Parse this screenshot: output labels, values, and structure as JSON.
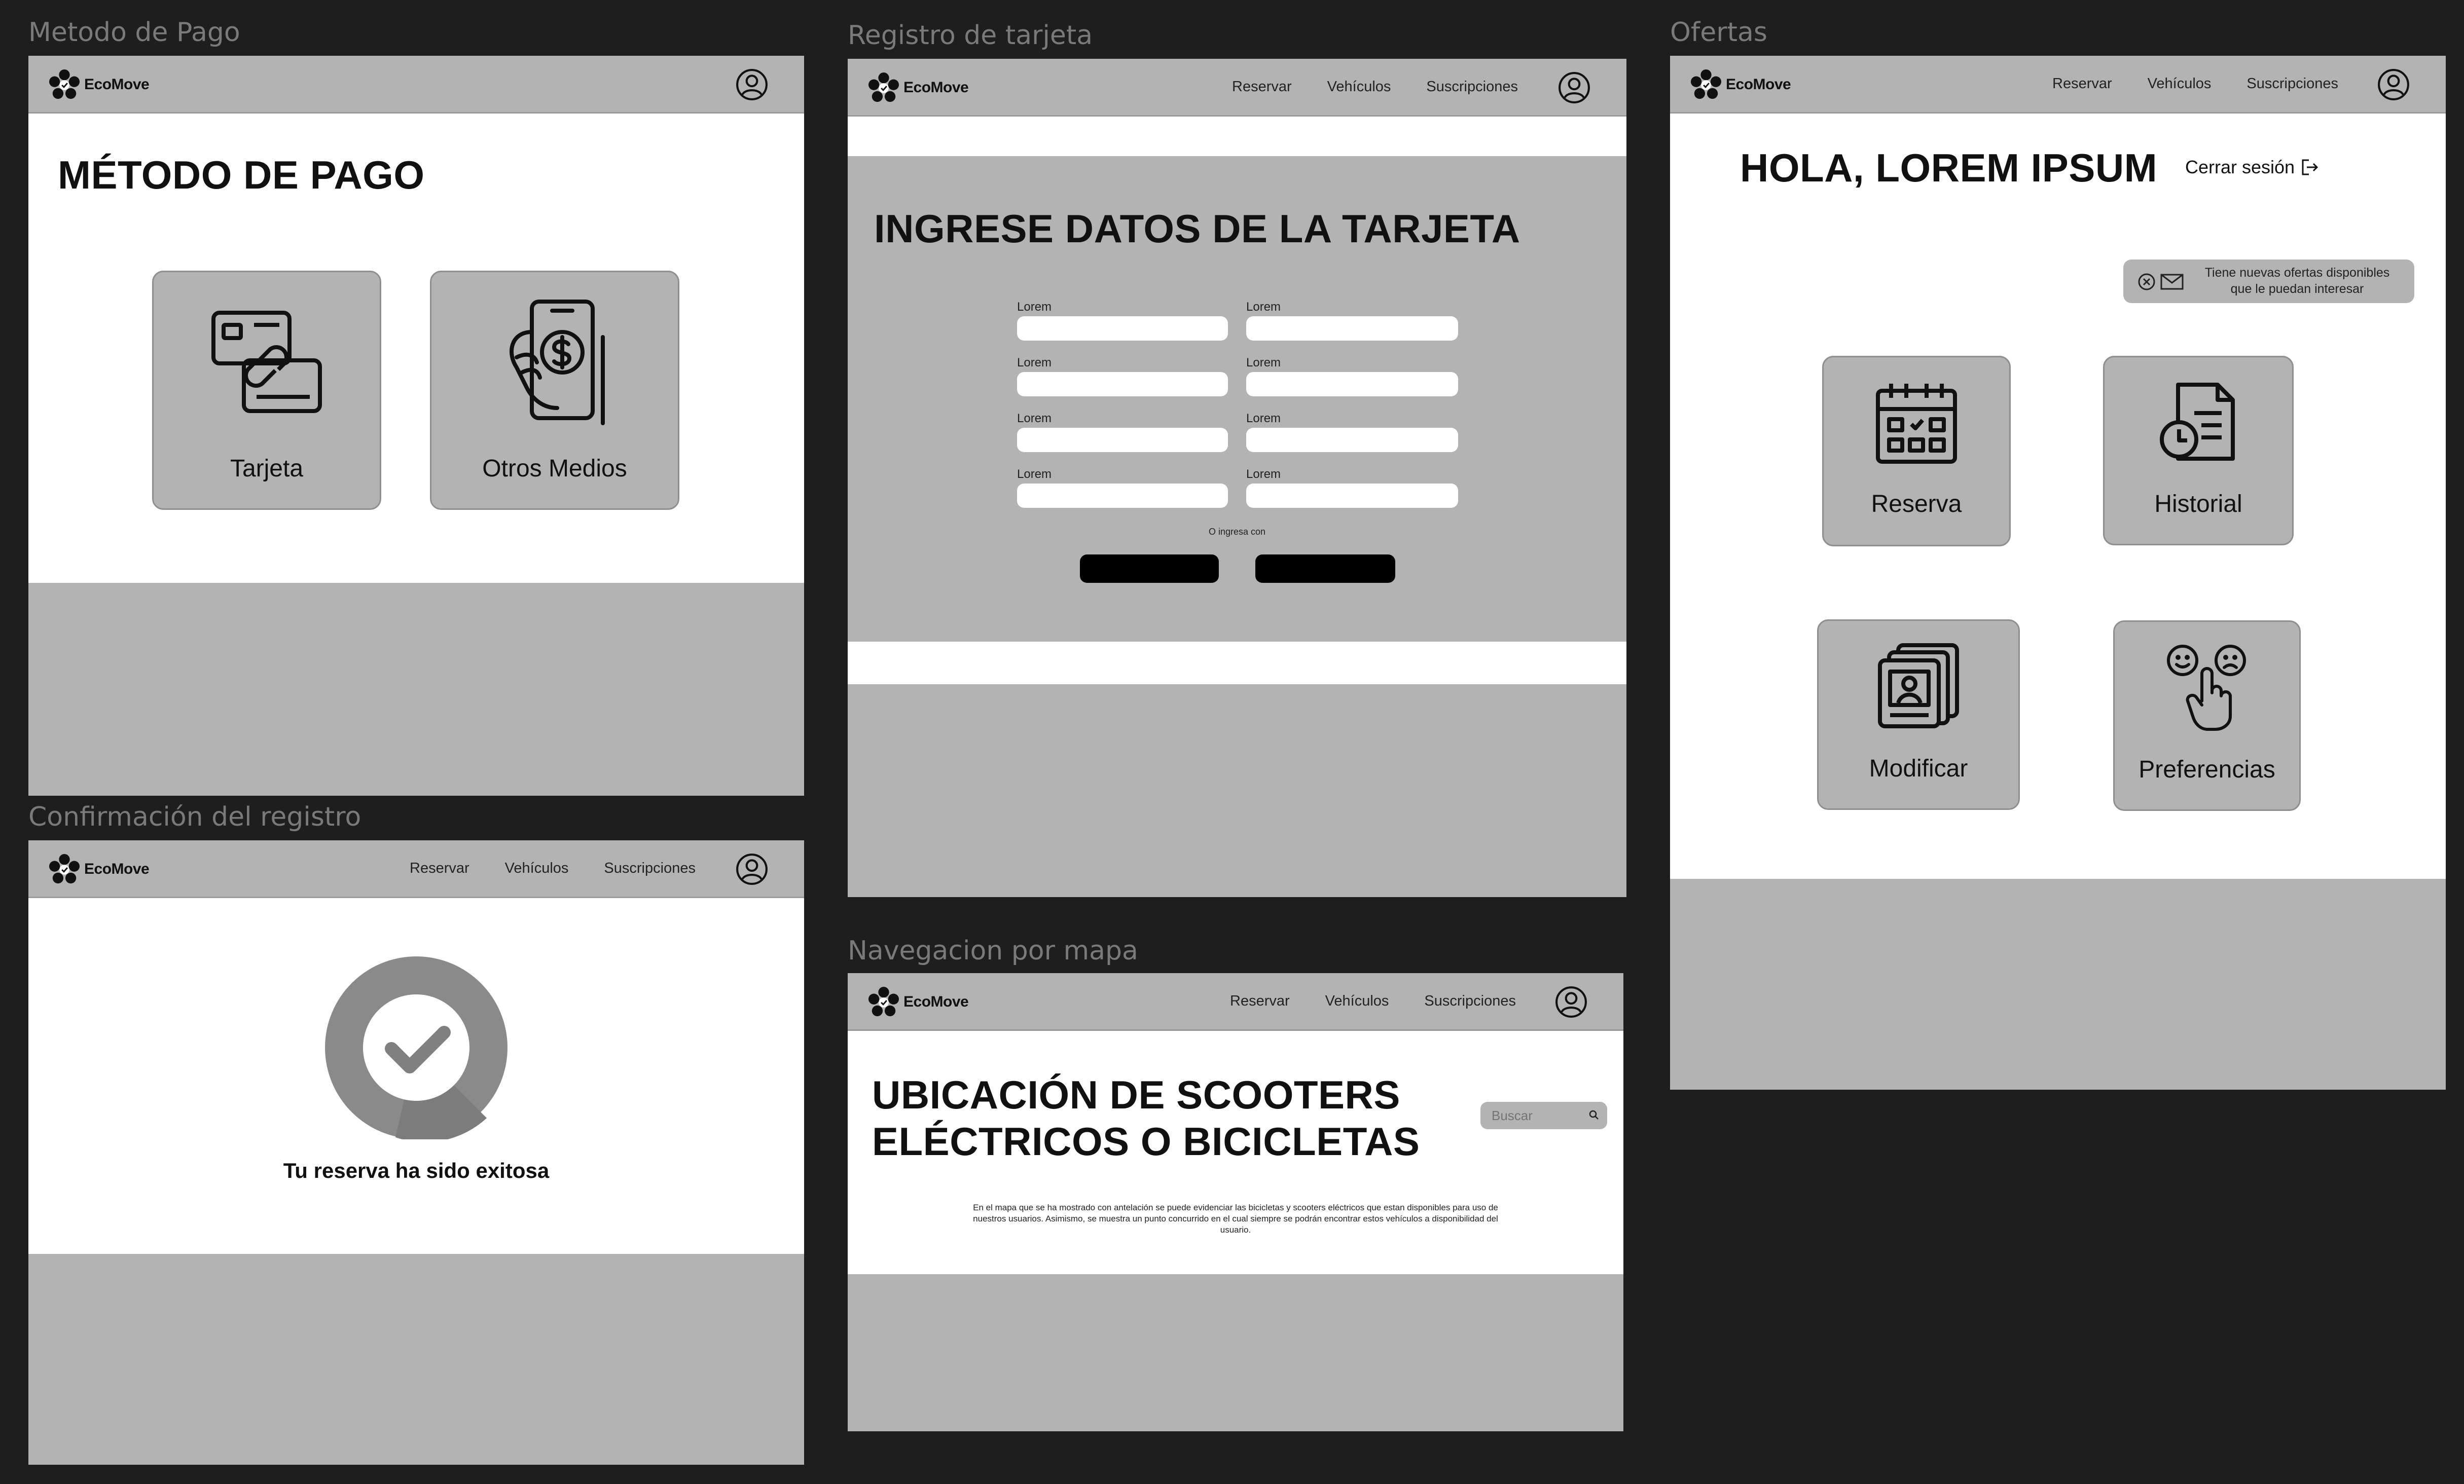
{
  "brand": {
    "name": "EcoMove"
  },
  "nav": {
    "reservar": "Reservar",
    "vehiculos": "Vehículos",
    "suscripciones": "Suscripciones"
  },
  "frames": {
    "metodo_pago": {
      "label": "Metodo de Pago",
      "title": "MÉTODO DE PAGO",
      "options": [
        {
          "label": "Tarjeta",
          "icon": "card-link-icon"
        },
        {
          "label": "Otros Medios",
          "icon": "phone-payment-icon"
        }
      ]
    },
    "registro_tarjeta": {
      "label": "Registro de tarjeta",
      "title": "INGRESE DATOS DE LA TARJETA",
      "field_label": "Lorem",
      "alt_text": "O ingresa con"
    },
    "ofertas": {
      "label": "Ofertas",
      "greeting": "HOLA, LOREM IPSUM",
      "logout": "Cerrar sesión",
      "notification": [
        "Tiene nuevas ofertas disponibles",
        "que le puedan interesar"
      ],
      "tiles": [
        {
          "label": "Reserva",
          "icon": "calendar-icon"
        },
        {
          "label": "Historial",
          "icon": "history-document-icon"
        },
        {
          "label": "Modificar",
          "icon": "profile-edit-icon"
        },
        {
          "label": "Preferencias",
          "icon": "emoji-feedback-icon"
        }
      ]
    },
    "confirmacion": {
      "label": "Confirmación del registro",
      "message": "Tu reserva ha sido exitosa"
    },
    "mapa": {
      "label": "Navegacion por mapa",
      "title_line1": "UBICACIÓN DE SCOOTERS",
      "title_line2": "ELÉCTRICOS O BICICLETAS",
      "search_placeholder": "Buscar",
      "description": [
        "En el mapa que se ha mostrado con antelación se puede evidenciar las bicicletas y scooters eléctricos que estan disponibles para uso de",
        "nuestros usuarios. Asimismo, se muestra un punto concurrido en el cual siempre se podrán encontrar estos vehículos a disponibilidad del",
        "usuario."
      ]
    }
  },
  "colors": {
    "background": "#1e1e1e",
    "frame_gray": "#b3b3b3",
    "white": "#ffffff",
    "check_circle": "#8a8a8a"
  }
}
